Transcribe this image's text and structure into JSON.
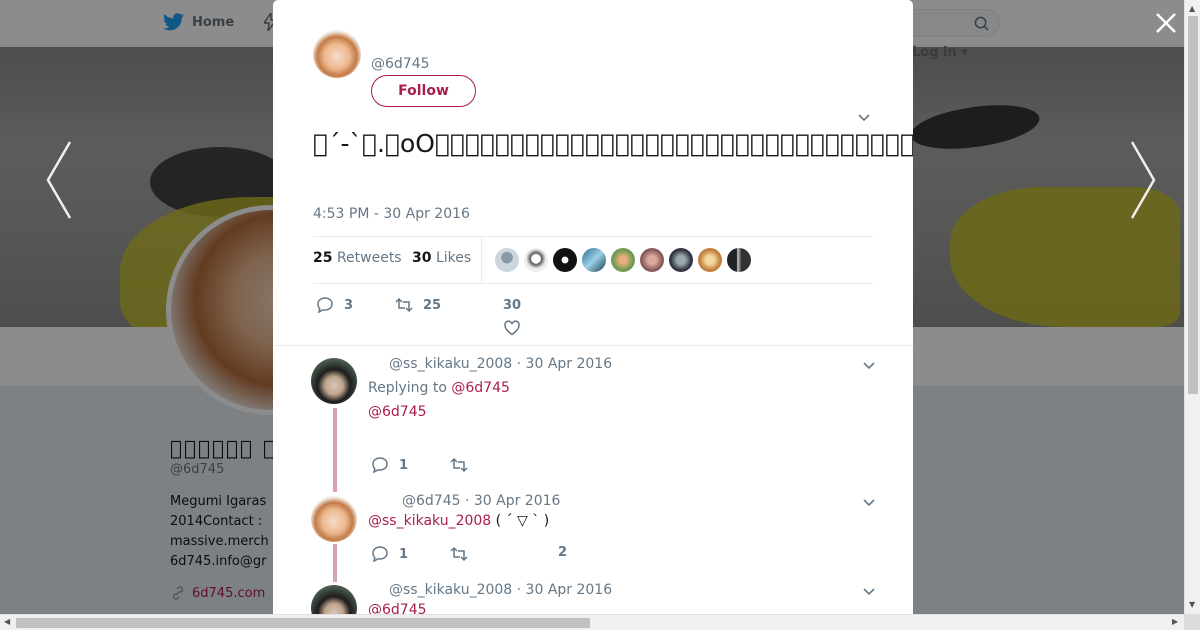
{
  "nav": {
    "home_label": "Home",
    "login_label": "Log in"
  },
  "profile": {
    "name": "\u0000\u0000\u0000\u0000\u0000\u0000 \u0000\u0000",
    "handle": "@6d745",
    "bio": "Megumi Igaras\n2014Contact :\nmassive.merch\n6d745.info@gr",
    "link": "6d745.com"
  },
  "modal": {
    "handle": "@6d745",
    "follow_label": "Follow",
    "tweet_text": "\u0000´-`\u0000.\u0000oO\u0000\u0000\u0000\u0000\u0000\u0000\u0000\u0000\u0000\u0000\u0000\u0000\u0000\u0000\u0000\u0000\u0000\u0000\u0000\u0000\u0000\u0000\u0000\u0000\u0000\u0000\u0000\u0000\u0000\u0000\u0000\u0000\u0000\u0000\u0000\u0000\u0000\u0000\u0000\u0000\u0000\u0000\u0000\u0000\u0000\u0000\u0000",
    "timestamp": "4:53 PM - 30 Apr 2016",
    "retweets_count": "25",
    "retweets_label": "Retweets",
    "likes_count": "30",
    "likes_label": "Likes",
    "reply_count": "3",
    "retweet_action_count": "25",
    "like_action_count": "30"
  },
  "replies": [
    {
      "header": "@ss_kikaku_2008 · 30 Apr 2016",
      "replying_to_prefix": "Replying to ",
      "replying_to_handle": "@6d745",
      "mention": "@6d745",
      "text": "",
      "reply_count": "1",
      "like_count": ""
    },
    {
      "header": "@6d745 · 30 Apr 2016",
      "mention": "@ss_kikaku_2008",
      "text": " ( ´ ▽ ` )",
      "reply_count": "1",
      "like_count": "2"
    },
    {
      "header": "@ss_kikaku_2008 · 30 Apr 2016",
      "mention": "@6d745"
    }
  ],
  "colors": {
    "accent": "#aa1d4f",
    "muted": "#657786",
    "thread_line": "#d8a3b6"
  }
}
